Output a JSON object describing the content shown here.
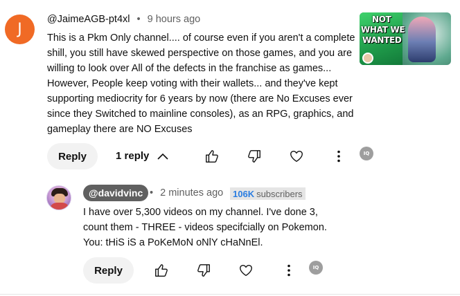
{
  "top_comment": {
    "avatar_letter": "J",
    "avatar_color": "#f06a25",
    "handle": "@JaimeAGB-pt4xl",
    "separator": "•",
    "timestamp": "9 hours ago",
    "lines": [
      "This is a Pkm Only channel.... of course even if you aren't a complete",
      "shill, you still have skewed perspective  on those games, and you are",
      "willing to look over All of the defects in the franchise as games...",
      "However, People keep voting with their wallets... and they've kept",
      "supporting mediocrity for 6 years by now (there are No Excuses ever",
      "since they Switched to mainline consoles), as an RPG, graphics, and",
      "gameplay there are NO Excuses"
    ],
    "reply_label": "Reply",
    "replies_count_label": "1 reply",
    "thumbnail": {
      "text_line1": "NOT",
      "text_line2": "WHAT WE",
      "text_line3": "WANTED"
    }
  },
  "reply_comment": {
    "handle": "@davidvinc",
    "separator": "•",
    "timestamp": "2 minutes ago",
    "subscribers_number": "106K",
    "subscribers_label": "subscribers",
    "lines": [
      "I have over 5,300 videos on my channel. I've done 3,",
      "count them - THREE - videos specifcially on Pokemon.",
      "You: tHiS iS a PoKeMoN oNlY cHaNnEl."
    ],
    "reply_label": "Reply"
  },
  "icons": {
    "like": "thumbs-up-icon",
    "dislike": "thumbs-down-icon",
    "heart": "heart-icon",
    "more": "more-vert-icon",
    "sponsor": "sponsor-badge-icon",
    "sponsor_text": "IQ"
  },
  "colors": {
    "reply_button_bg": "#f2f2f2",
    "owner_badge_bg": "#606060",
    "subscribers_accent": "#2a7de1"
  }
}
